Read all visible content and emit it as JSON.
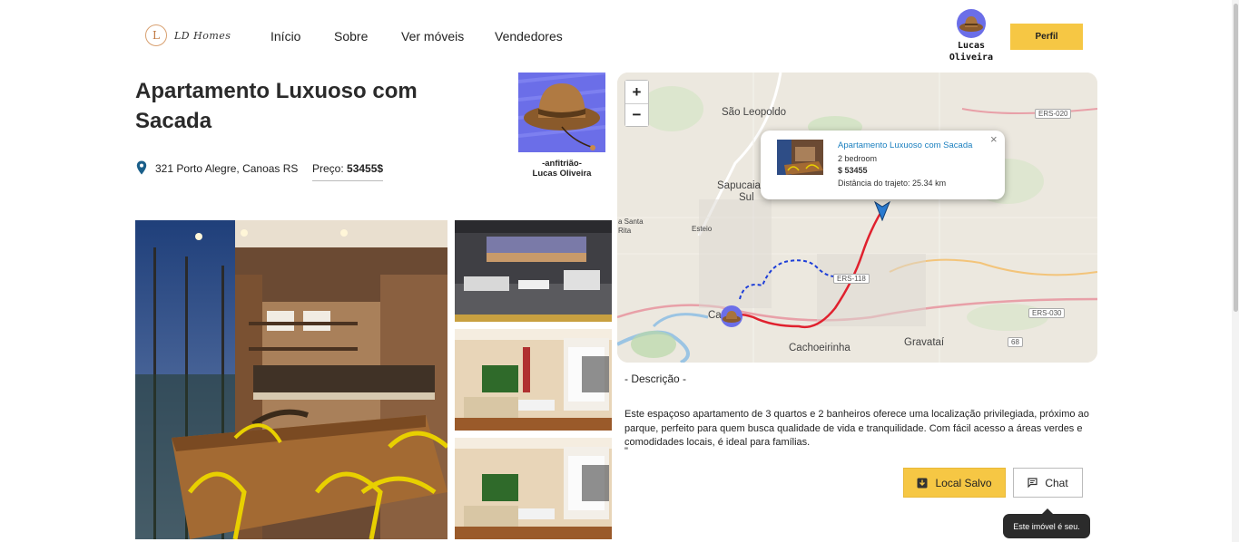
{
  "header": {
    "logo_letter": "L",
    "logo_text": "LD Homes",
    "nav": [
      "Início",
      "Sobre",
      "Ver móveis",
      "Vendedores"
    ],
    "user_name": "Lucas Oliveira",
    "profile_button": "Perfil"
  },
  "listing": {
    "title": "Apartamento Luxuoso com Sacada",
    "address": "321 Porto Alegre, Canoas RS",
    "price_label": "Preço:",
    "price_value": "53455$",
    "host_role": "-anfitrião-",
    "host_name": "Lucas Oliveira"
  },
  "map": {
    "zoom_in": "+",
    "zoom_out": "−",
    "labels": [
      "São Leopoldo",
      "Sapucaia",
      "Sul",
      "Esteio",
      "a Santa",
      "Rita",
      "Ca",
      "Cachoeirinha",
      "Gravataí"
    ],
    "roads": [
      "ERS-020",
      "ERS-118",
      "ERS-030",
      "ERS-030",
      "68"
    ],
    "popup": {
      "close": "×",
      "title": "Apartamento Luxuoso com Sacada",
      "bedrooms": "2 bedroom",
      "price": "$ 53455",
      "distance": "Distância do trajeto: 25.34 km"
    }
  },
  "description": {
    "heading": "- Descrição -",
    "text": "Este espaçoso apartamento de 3 quartos e 2 banheiros oferece uma localização privilegiada, próximo ao parque, perfeito para quem busca qualidade de vida e tranquilidade. Com fácil acesso a áreas verdes e comodidades locais, é ideal para famílias.",
    "trailing": "\""
  },
  "actions": {
    "saved_label": "Local Salvo",
    "chat_label": "Chat",
    "tooltip": "Este imóvel é seu."
  },
  "colors": {
    "accent": "#f6c744",
    "avatar_bg": "#6b6ee8",
    "link": "#1a7fbf",
    "route_red": "#e0212e",
    "route_blue": "#1e3fd8"
  }
}
